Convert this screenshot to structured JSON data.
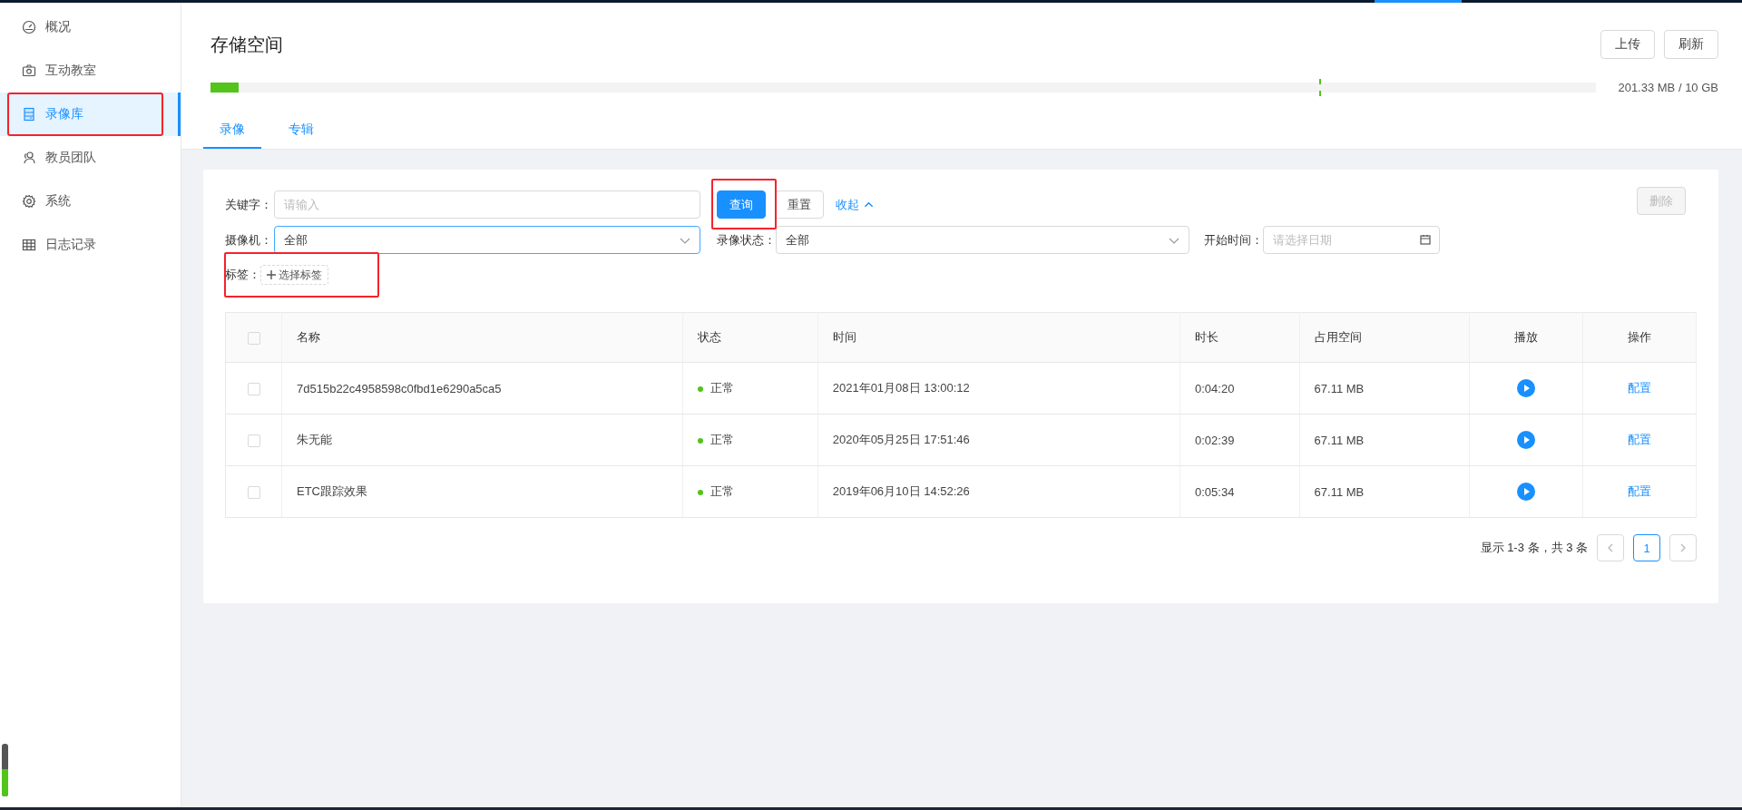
{
  "sidebar": {
    "items": [
      {
        "label": "概况",
        "selected": false,
        "highlighted": false
      },
      {
        "label": "互动教室",
        "selected": false,
        "highlighted": false
      },
      {
        "label": "录像库",
        "selected": true,
        "highlighted": true
      },
      {
        "label": "教员团队",
        "selected": false,
        "highlighted": false
      },
      {
        "label": "系统",
        "selected": false,
        "highlighted": false
      },
      {
        "label": "日志记录",
        "selected": false,
        "highlighted": false
      }
    ]
  },
  "header": {
    "title": "存储空间",
    "buttons": [
      {
        "label": "上传"
      },
      {
        "label": "刷新"
      }
    ],
    "storage": {
      "level": 0.02,
      "reading": "201.33 MB / 10 GB"
    },
    "tabs": [
      {
        "label": "录像",
        "selected": true
      },
      {
        "label": "专辑",
        "selected": false
      }
    ]
  },
  "filters": {
    "keyword": {
      "label": "关键字：",
      "placeholder": "请输入"
    },
    "search_button": {
      "label": "查询",
      "highlighted": true
    },
    "reset_button": {
      "label": "重置"
    },
    "collapse_link": {
      "label": "收起"
    },
    "delete_button": {
      "label": "删除",
      "disabled": true
    },
    "camera": {
      "label": "摄像机：",
      "value": "全部",
      "focused": true
    },
    "record_status": {
      "label": "录像状态：",
      "value": "全部",
      "focused": false
    },
    "start_time": {
      "label": "开始时间：",
      "placeholder": "请选择日期"
    },
    "tags": {
      "label": "标签：",
      "button": "选择标签",
      "highlighted": true
    }
  },
  "table": {
    "header_checked": false,
    "columns": [
      "名称",
      "状态",
      "时间",
      "时长",
      "占用空间",
      "播放",
      "操作"
    ],
    "rows": [
      {
        "checked": false,
        "name": "7d515b22c4958598c0fbd1e6290a5ca5",
        "status": {
          "label": "正常",
          "color": "#52c41a"
        },
        "time": "2021年01月08日 13:00:12",
        "duration": "0:04:20",
        "size": "67.11 MB",
        "action": "配置"
      },
      {
        "checked": false,
        "name": "朱无能",
        "status": {
          "label": "正常",
          "color": "#52c41a"
        },
        "time": "2020年05月25日 17:51:46",
        "duration": "0:02:39",
        "size": "67.11 MB",
        "action": "配置"
      },
      {
        "checked": false,
        "name": "ETC跟踪效果",
        "status": {
          "label": "正常",
          "color": "#52c41a"
        },
        "time": "2019年06月10日 14:52:26",
        "duration": "0:05:34",
        "size": "67.11 MB",
        "action": "配置"
      }
    ]
  },
  "pagination": {
    "summary": "显示 1-3 条，共 3 条",
    "pages": [
      {
        "label": "1",
        "selected": true
      }
    ]
  }
}
